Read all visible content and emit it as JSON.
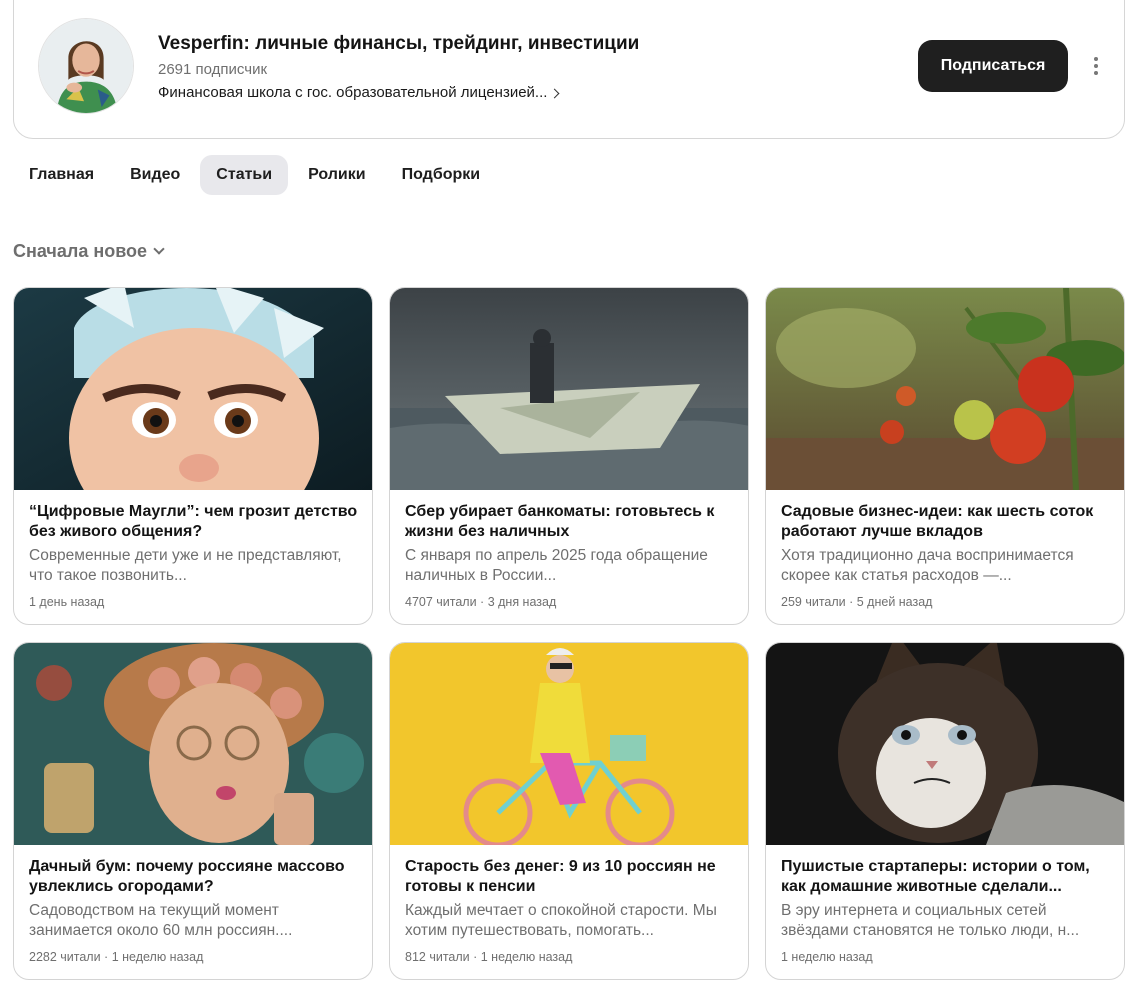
{
  "channel": {
    "title": "Vesperfin: личные финансы, трейдинг, инвестиции",
    "subscribers": "2691 подписчик",
    "description": "Финансовая школа с гос. образовательной лицензией...",
    "subscribe_label": "Подписаться",
    "avatar_icon": "avatar-photo"
  },
  "tabs": [
    {
      "label": "Главная",
      "active": false
    },
    {
      "label": "Видео",
      "active": false
    },
    {
      "label": "Статьи",
      "active": true
    },
    {
      "label": "Ролики",
      "active": false
    },
    {
      "label": "Подборки",
      "active": false
    }
  ],
  "sort": {
    "label": "Сначала новое"
  },
  "articles": [
    {
      "title": "“Цифровые Маугли”: чем грозит детство без живого общения?",
      "excerpt": "Современные дети уже и не представляют, что такое позвонить...",
      "meta": "1 день назад",
      "thumb": "cartoon-child-image"
    },
    {
      "title": "Сбер убирает банкоматы: готовьтесь к жизни без наличных",
      "excerpt": "С января по апрель 2025 года обращение наличных в России...",
      "meta": "4707 читали · 3 дня назад",
      "thumb": "dollar-paper-boat-image"
    },
    {
      "title": "Садовые бизнес-идеи: как шесть соток работают лучше вкладов",
      "excerpt": "Хотя традиционно дача воспринимается скорее как статья расходов —...",
      "meta": "259 читали · 5 дней назад",
      "thumb": "tomato-plant-image"
    },
    {
      "title": "Дачный бум: почему россияне массово увлеклись огородами?",
      "excerpt": "Садоводством на текущий момент занимается около 60 млн россиян....",
      "meta": "2282 читали · 1 неделю назад",
      "thumb": "woman-curlers-image"
    },
    {
      "title": "Старость без денег: 9 из 10 россиян не готовы к пенсии",
      "excerpt": "Каждый мечтает о спокойной старости. Мы хотим путешествовать, помогать...",
      "meta": "812 читали · 1 неделю назад",
      "thumb": "elderly-woman-bicycle-image"
    },
    {
      "title": "Пушистые стартаперы: истории о том, как домашние животные сделали...",
      "excerpt": "В эру интернета и социальных сетей звёздами становятся не только люди, н...",
      "meta": "1 неделю назад",
      "thumb": "grumpy-cat-image"
    }
  ],
  "colors": {
    "subscribe_bg": "#1f1f1f",
    "active_tab_bg": "#e8e8ec",
    "muted_text": "#6f6f6f",
    "border": "#d4d4d4"
  }
}
